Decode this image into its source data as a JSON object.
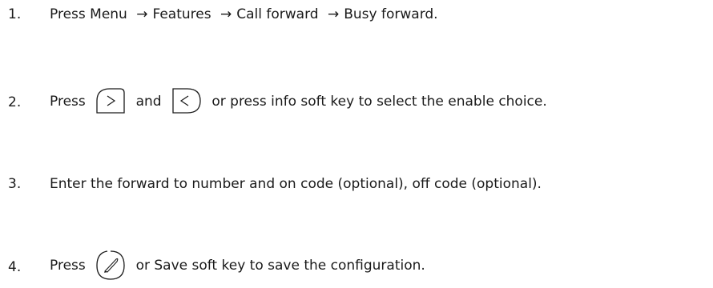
{
  "steps": [
    {
      "number": "1.",
      "text": {
        "t1": "Press Menu",
        "a1": "→",
        "t2": "Features",
        "a2": "→",
        "t3": "Call forward",
        "a3": "→",
        "t4": "Busy forward."
      }
    },
    {
      "number": "2.",
      "text": {
        "t1": "Press",
        "t2": "and",
        "t3": "or press info soft key to select the enable choice."
      },
      "icons": [
        "right-navigation-key-icon",
        "left-navigation-key-icon"
      ]
    },
    {
      "number": "3.",
      "text": {
        "t1": "Enter the forward to number and on code (optional), off code (optional)."
      }
    },
    {
      "number": "4.",
      "text": {
        "t1": "Press",
        "t2": "or Save soft key to save the configuration."
      },
      "icons": [
        "ok-checkmark-key-icon"
      ]
    }
  ]
}
